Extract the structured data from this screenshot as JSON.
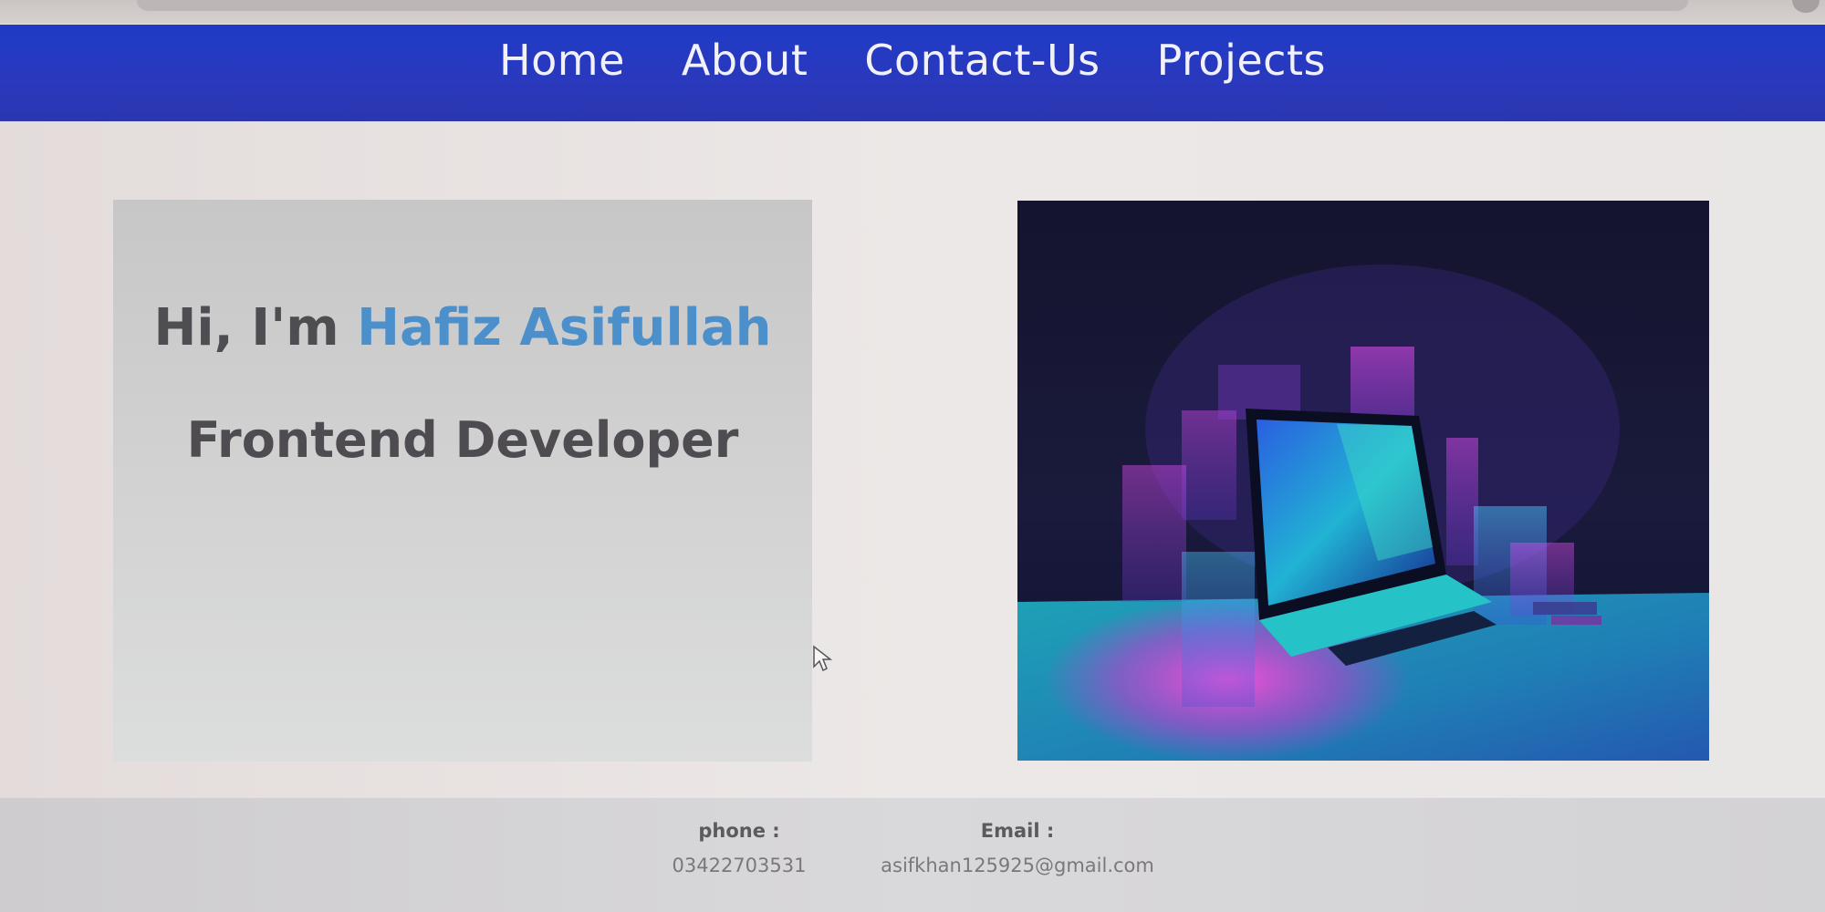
{
  "nav": {
    "items": [
      {
        "label": "Home"
      },
      {
        "label": "About"
      },
      {
        "label": "Contact-Us"
      },
      {
        "label": "Projects"
      }
    ]
  },
  "intro": {
    "greeting": "Hi, I'm",
    "name": "Hafiz Asifullah",
    "role": "Frontend Developer"
  },
  "hero_image": {
    "subject": "neon laptop illustration"
  },
  "footer": {
    "phone_label": "phone :",
    "phone_value": "03422703531",
    "email_label": "Email :",
    "email_value": "asifkhan125925@gmail.com"
  },
  "colors": {
    "nav_background": "#2a39bd",
    "name_accent": "#4b8fcb",
    "heading_text": "#4d4d52"
  }
}
